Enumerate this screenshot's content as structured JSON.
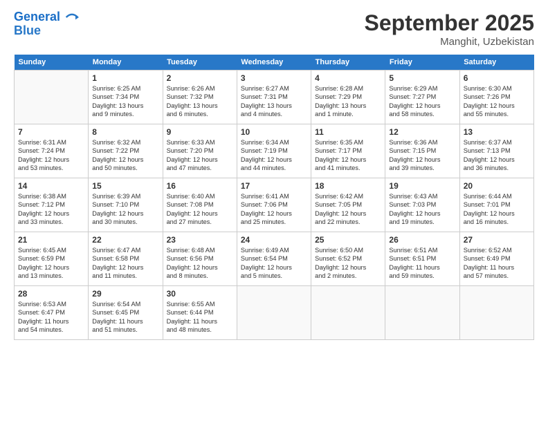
{
  "logo": {
    "line1": "General",
    "line2": "Blue"
  },
  "title": "September 2025",
  "subtitle": "Manghit, Uzbekistan",
  "weekdays": [
    "Sunday",
    "Monday",
    "Tuesday",
    "Wednesday",
    "Thursday",
    "Friday",
    "Saturday"
  ],
  "weeks": [
    [
      {
        "day": "",
        "info": ""
      },
      {
        "day": "1",
        "info": "Sunrise: 6:25 AM\nSunset: 7:34 PM\nDaylight: 13 hours\nand 9 minutes."
      },
      {
        "day": "2",
        "info": "Sunrise: 6:26 AM\nSunset: 7:32 PM\nDaylight: 13 hours\nand 6 minutes."
      },
      {
        "day": "3",
        "info": "Sunrise: 6:27 AM\nSunset: 7:31 PM\nDaylight: 13 hours\nand 4 minutes."
      },
      {
        "day": "4",
        "info": "Sunrise: 6:28 AM\nSunset: 7:29 PM\nDaylight: 13 hours\nand 1 minute."
      },
      {
        "day": "5",
        "info": "Sunrise: 6:29 AM\nSunset: 7:27 PM\nDaylight: 12 hours\nand 58 minutes."
      },
      {
        "day": "6",
        "info": "Sunrise: 6:30 AM\nSunset: 7:26 PM\nDaylight: 12 hours\nand 55 minutes."
      }
    ],
    [
      {
        "day": "7",
        "info": "Sunrise: 6:31 AM\nSunset: 7:24 PM\nDaylight: 12 hours\nand 53 minutes."
      },
      {
        "day": "8",
        "info": "Sunrise: 6:32 AM\nSunset: 7:22 PM\nDaylight: 12 hours\nand 50 minutes."
      },
      {
        "day": "9",
        "info": "Sunrise: 6:33 AM\nSunset: 7:20 PM\nDaylight: 12 hours\nand 47 minutes."
      },
      {
        "day": "10",
        "info": "Sunrise: 6:34 AM\nSunset: 7:19 PM\nDaylight: 12 hours\nand 44 minutes."
      },
      {
        "day": "11",
        "info": "Sunrise: 6:35 AM\nSunset: 7:17 PM\nDaylight: 12 hours\nand 41 minutes."
      },
      {
        "day": "12",
        "info": "Sunrise: 6:36 AM\nSunset: 7:15 PM\nDaylight: 12 hours\nand 39 minutes."
      },
      {
        "day": "13",
        "info": "Sunrise: 6:37 AM\nSunset: 7:13 PM\nDaylight: 12 hours\nand 36 minutes."
      }
    ],
    [
      {
        "day": "14",
        "info": "Sunrise: 6:38 AM\nSunset: 7:12 PM\nDaylight: 12 hours\nand 33 minutes."
      },
      {
        "day": "15",
        "info": "Sunrise: 6:39 AM\nSunset: 7:10 PM\nDaylight: 12 hours\nand 30 minutes."
      },
      {
        "day": "16",
        "info": "Sunrise: 6:40 AM\nSunset: 7:08 PM\nDaylight: 12 hours\nand 27 minutes."
      },
      {
        "day": "17",
        "info": "Sunrise: 6:41 AM\nSunset: 7:06 PM\nDaylight: 12 hours\nand 25 minutes."
      },
      {
        "day": "18",
        "info": "Sunrise: 6:42 AM\nSunset: 7:05 PM\nDaylight: 12 hours\nand 22 minutes."
      },
      {
        "day": "19",
        "info": "Sunrise: 6:43 AM\nSunset: 7:03 PM\nDaylight: 12 hours\nand 19 minutes."
      },
      {
        "day": "20",
        "info": "Sunrise: 6:44 AM\nSunset: 7:01 PM\nDaylight: 12 hours\nand 16 minutes."
      }
    ],
    [
      {
        "day": "21",
        "info": "Sunrise: 6:45 AM\nSunset: 6:59 PM\nDaylight: 12 hours\nand 13 minutes."
      },
      {
        "day": "22",
        "info": "Sunrise: 6:47 AM\nSunset: 6:58 PM\nDaylight: 12 hours\nand 11 minutes."
      },
      {
        "day": "23",
        "info": "Sunrise: 6:48 AM\nSunset: 6:56 PM\nDaylight: 12 hours\nand 8 minutes."
      },
      {
        "day": "24",
        "info": "Sunrise: 6:49 AM\nSunset: 6:54 PM\nDaylight: 12 hours\nand 5 minutes."
      },
      {
        "day": "25",
        "info": "Sunrise: 6:50 AM\nSunset: 6:52 PM\nDaylight: 12 hours\nand 2 minutes."
      },
      {
        "day": "26",
        "info": "Sunrise: 6:51 AM\nSunset: 6:51 PM\nDaylight: 11 hours\nand 59 minutes."
      },
      {
        "day": "27",
        "info": "Sunrise: 6:52 AM\nSunset: 6:49 PM\nDaylight: 11 hours\nand 57 minutes."
      }
    ],
    [
      {
        "day": "28",
        "info": "Sunrise: 6:53 AM\nSunset: 6:47 PM\nDaylight: 11 hours\nand 54 minutes."
      },
      {
        "day": "29",
        "info": "Sunrise: 6:54 AM\nSunset: 6:45 PM\nDaylight: 11 hours\nand 51 minutes."
      },
      {
        "day": "30",
        "info": "Sunrise: 6:55 AM\nSunset: 6:44 PM\nDaylight: 11 hours\nand 48 minutes."
      },
      {
        "day": "",
        "info": ""
      },
      {
        "day": "",
        "info": ""
      },
      {
        "day": "",
        "info": ""
      },
      {
        "day": "",
        "info": ""
      }
    ]
  ]
}
